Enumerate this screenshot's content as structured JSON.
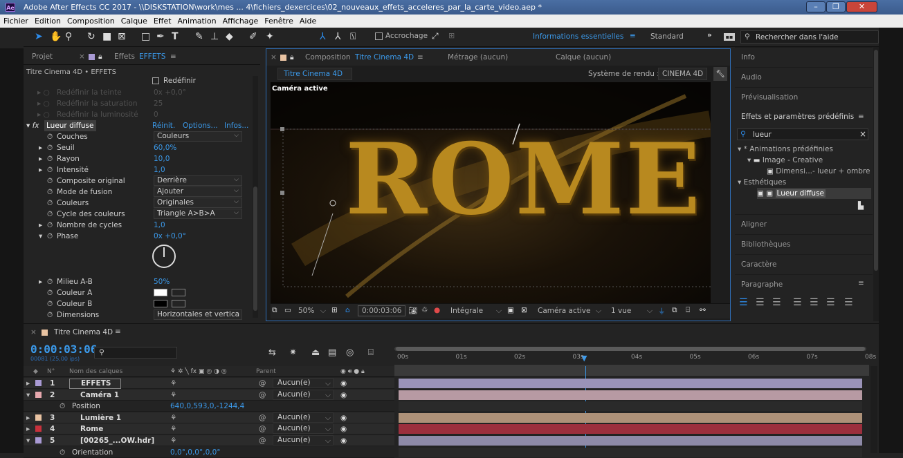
{
  "window": {
    "title": "Adobe After Effects CC 2017 - \\\\DISKSTATION\\work\\mes ... 4\\fichiers_dexercices\\02_nouveaux_effets_acceleres_par_la_carte_video.aep *",
    "app_badge": "Ae"
  },
  "menu": [
    "Fichier",
    "Edition",
    "Composition",
    "Calque",
    "Effet",
    "Animation",
    "Affichage",
    "Fenêtre",
    "Aide"
  ],
  "toolbar": {
    "snapping": "Accrochage",
    "workspace_active": "Informations essentielles",
    "workspace_menu": "≡",
    "workspace_other": "Standard",
    "overflow": "»",
    "search_placeholder": "Rechercher dans l'aide"
  },
  "left_panel": {
    "tab_project": "Projet",
    "tab_effects_prefix": "Effets",
    "tab_effects_name": "EFFETS",
    "breadcrumb": "Titre Cinema 4D • EFFETS",
    "redefine": "Redéfinir",
    "faded": [
      {
        "label": "Redéfinir la teinte",
        "value": "0x +0,0°"
      },
      {
        "label": "Redéfinir la saturation",
        "value": "25"
      },
      {
        "label": "Redéfinir la luminosité",
        "value": "0"
      }
    ],
    "effect_name": "Lueur diffuse",
    "reset": "Réinit.",
    "options": "Options...",
    "infos": "Infos...",
    "props": [
      {
        "label": "Couches",
        "kind": "dd",
        "value": "Couleurs",
        "tw": false
      },
      {
        "label": "Seuil",
        "kind": "val",
        "value": "60,0%",
        "tw": true
      },
      {
        "label": "Rayon",
        "kind": "val",
        "value": "10,0",
        "tw": true
      },
      {
        "label": "Intensité",
        "kind": "val",
        "value": "1,0",
        "tw": true
      },
      {
        "label": "Composite original",
        "kind": "dd",
        "value": "Derrière",
        "tw": false
      },
      {
        "label": "Mode de fusion",
        "kind": "dd",
        "value": "Ajouter",
        "tw": false
      },
      {
        "label": "Couleurs",
        "kind": "dd",
        "value": "Originales",
        "tw": false
      },
      {
        "label": "Cycle des couleurs",
        "kind": "dd",
        "value": "Triangle A>B>A",
        "tw": false
      },
      {
        "label": "Nombre de cycles",
        "kind": "val",
        "value": "1,0",
        "tw": true
      },
      {
        "label": "Phase",
        "kind": "val",
        "value": "0x +0,0°",
        "tw": true,
        "open": true
      }
    ],
    "props2": [
      {
        "label": "Milieu A-B",
        "kind": "val",
        "value": "50%",
        "tw": true
      },
      {
        "label": "Couleur A",
        "kind": "color",
        "value": "#ffffff",
        "tw": false
      },
      {
        "label": "Couleur B",
        "kind": "color",
        "value": "#000000",
        "tw": false
      },
      {
        "label": "Dimensions",
        "kind": "dd",
        "value": "Horizontales et vertica",
        "tw": false
      }
    ]
  },
  "comp": {
    "tab_prefix": "Composition",
    "tab_name": "Titre Cinema 4D",
    "tab_footage": "Métrage (aucun)",
    "tab_layer": "Calque (aucun)",
    "subtab": "Titre Cinema 4D",
    "renderer_label": "Système de rendu :",
    "renderer": "CINEMA 4D",
    "camera_label": "Caméra active",
    "title_text": "ROME",
    "footer": {
      "zoom": "50%",
      "timecode": "0:00:03:06",
      "resolution": "Intégrale",
      "camera": "Caméra active",
      "views": "1 vue"
    }
  },
  "right_panel": {
    "items_top": [
      "Info",
      "Audio",
      "Prévisualisation"
    ],
    "effects_title": "Effets et paramètres prédéfinis",
    "search_value": "lueur",
    "tree": [
      "* Animations prédéfinies",
      "Image - Creative",
      "Dimensi...- lueur + ombre",
      "Esthétiques",
      "Lueur diffuse"
    ],
    "items_bottom": [
      "Aligner",
      "Bibliothèques",
      "Caractère",
      "Paragraphe"
    ]
  },
  "timeline": {
    "tab": "Titre Cinema 4D",
    "timecode": "0:00:03:06",
    "frames": "00081 (25,00 ips)",
    "col_num": "N°",
    "col_name": "Nom des calques",
    "col_parent": "Parent",
    "ruler": [
      "00s",
      "01s",
      "02s",
      "03s",
      "04s",
      "05s",
      "06s",
      "07s",
      "08s"
    ],
    "layers": [
      {
        "num": "1",
        "name": "EFFETS",
        "parent": "Aucun(e)",
        "color": "#a99ad4",
        "bar": "#9a93b8",
        "open": false
      },
      {
        "num": "2",
        "name": "Caméra 1",
        "parent": "Aucun(e)",
        "color": "#e7a8ae",
        "bar": "#b79aa3",
        "open": true
      },
      {
        "sub": true,
        "name": "Position",
        "value": "640,0,593,0,-1244,4"
      },
      {
        "num": "3",
        "name": "Lumière 1",
        "parent": "Aucun(e)",
        "color": "#e9c3a2",
        "bar": "#ad9178",
        "open": false
      },
      {
        "num": "4",
        "name": "Rome",
        "parent": "Aucun(e)",
        "color": "#c8313c",
        "bar": "#9c2f3d",
        "open": false
      },
      {
        "num": "5",
        "name": "[00265_...OW.hdr]",
        "parent": "Aucun(e)",
        "color": "#a99ad4",
        "bar": "#8e8aa8",
        "open": true
      },
      {
        "sub": true,
        "name": "Orientation",
        "value": "0,0°,0,0°,0,0°"
      }
    ]
  }
}
